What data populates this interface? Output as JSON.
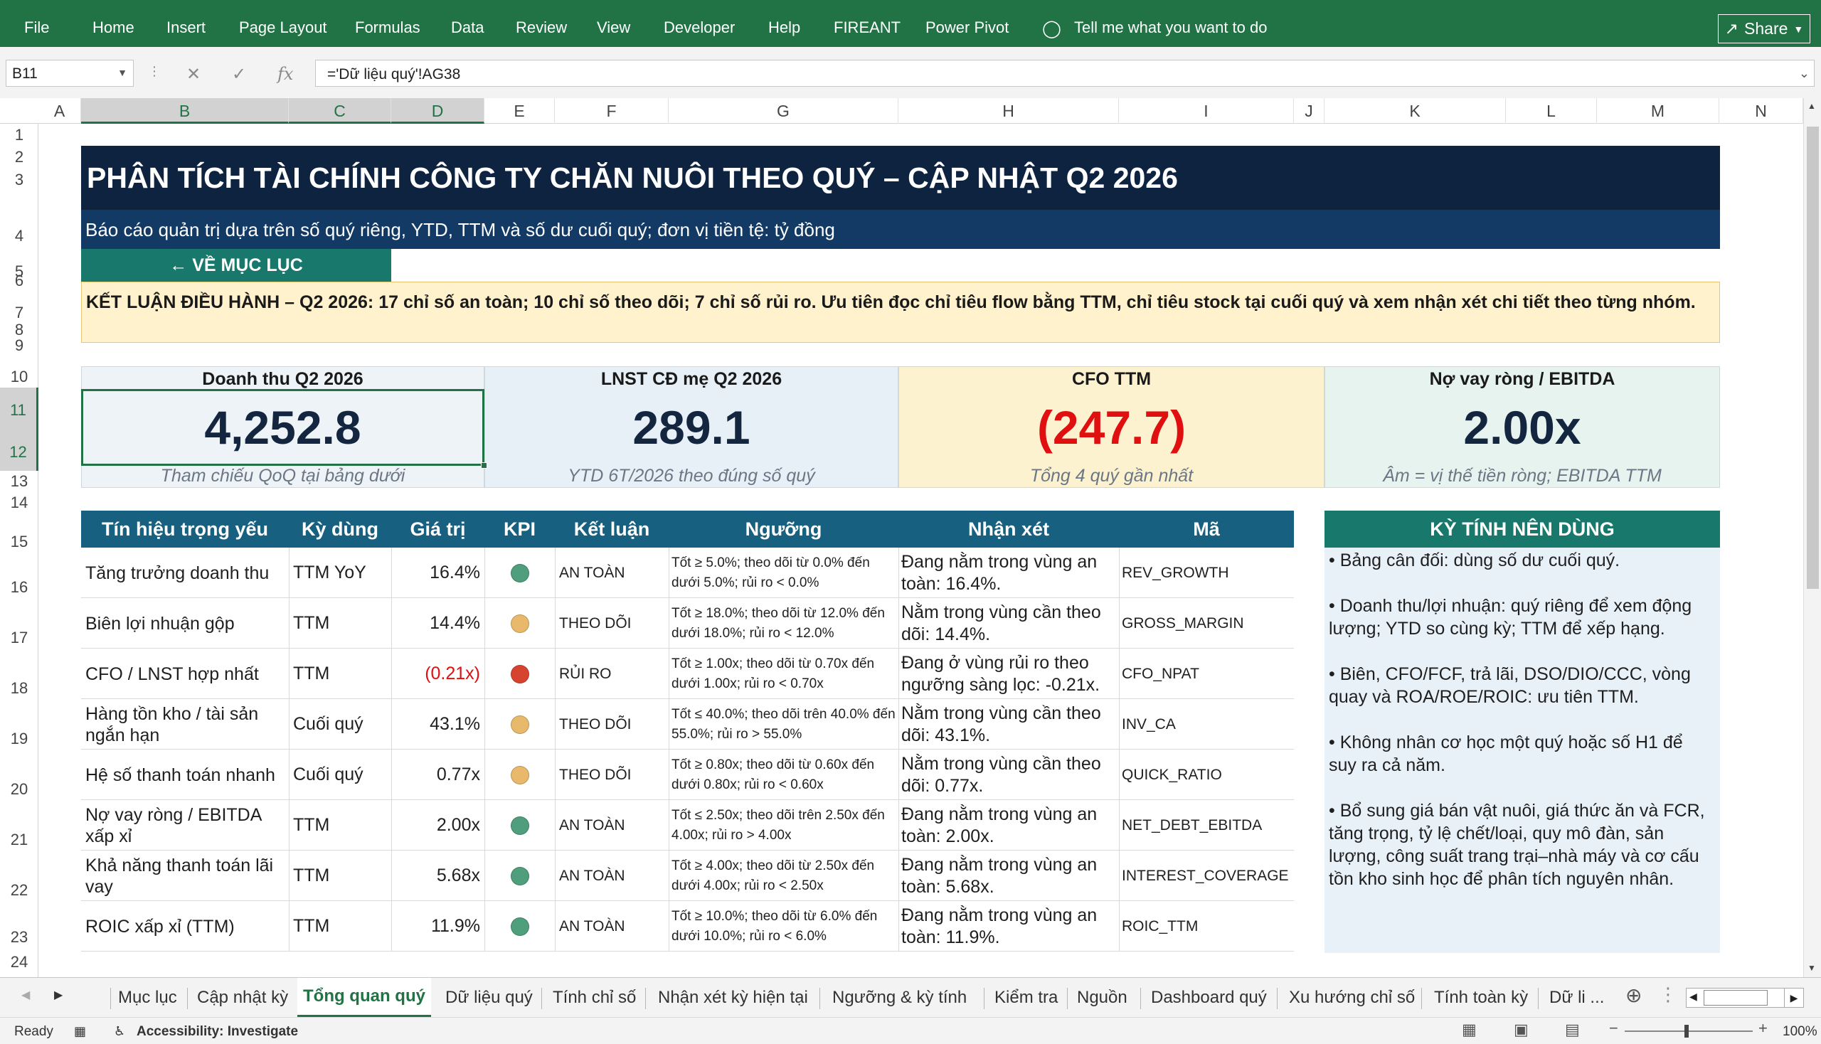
{
  "ribbon": {
    "tabs": [
      "File",
      "Home",
      "Insert",
      "Page Layout",
      "Formulas",
      "Data",
      "Review",
      "View",
      "Developer",
      "Help",
      "FIREANT",
      "Power Pivot"
    ],
    "tell_me": "Tell me what you want to do",
    "share": "Share"
  },
  "formula_bar": {
    "name_box": "B11",
    "formula": "='Dữ liệu quý'!AG38"
  },
  "columns": [
    "A",
    "B",
    "C",
    "D",
    "E",
    "F",
    "G",
    "H",
    "I",
    "J",
    "K",
    "L",
    "M",
    "N"
  ],
  "rows": [
    "1",
    "2",
    "3",
    "4",
    "5",
    "6",
    "7",
    "8",
    "9",
    "10",
    "11",
    "12",
    "13",
    "14",
    "15",
    "16",
    "17",
    "18",
    "19",
    "20",
    "21",
    "22",
    "23",
    "24"
  ],
  "sheet": {
    "title": "PHÂN TÍCH TÀI CHÍNH CÔNG TY CHĂN NUÔI THEO QUÝ – CẬP NHẬT Q2 2026",
    "subtitle": "Báo cáo quản trị dựa trên số quý riêng, YTD, TTM và số dư cuối quý; đơn vị tiền tệ: tỷ đồng",
    "back_button": "← VỀ MỤC LỤC",
    "summary": "KẾT LUẬN ĐIỀU HÀNH – Q2 2026: 17 chỉ số an toàn; 10 chỉ số theo dõi; 7 chỉ số rủi ro. Ưu tiên đọc chỉ tiêu flow bằng TTM, chỉ tiêu stock tại cuối quý và xem nhận xét chi tiết theo từng nhóm.",
    "kpis": [
      {
        "label": "Doanh thu Q2 2026",
        "value": "4,252.8",
        "note": "Tham chiếu QoQ tại bảng dưới",
        "bg": "#eef3f7"
      },
      {
        "label": "LNST CĐ mẹ Q2 2026",
        "value": "289.1",
        "note": "YTD 6T/2026 theo đúng số quý",
        "bg": "#e8f0f7"
      },
      {
        "label": "CFO TTM",
        "value": "(247.7)",
        "note": "Tổng 4 quý gần nhất",
        "bg": "#fdf2d0"
      },
      {
        "label": "Nợ vay ròng / EBITDA",
        "value": "2.00x",
        "note": "Âm = vị thế tiền ròng; EBITDA TTM",
        "bg": "#e6f3ee"
      }
    ],
    "signals_header": [
      "Tín hiệu trọng yếu",
      "Kỳ dùng",
      "Giá trị",
      "KPI",
      "Kết luận",
      "Ngưỡng",
      "Nhận xét",
      "Mã"
    ],
    "signals": [
      {
        "signal": "Tăng trưởng doanh thu",
        "period": "TTM YoY",
        "value": "16.4%",
        "status": "safe",
        "conclusion": "AN TOÀN",
        "threshold": "Tốt ≥ 5.0%; theo dõi từ 0.0% đến dưới 5.0%; rủi ro < 0.0%",
        "comment": "Đang nằm trong vùng an toàn: 16.4%.",
        "code": "REV_GROWTH"
      },
      {
        "signal": "Biên lợi nhuận gộp",
        "period": "TTM",
        "value": "14.4%",
        "status": "watch",
        "conclusion": "THEO DÕI",
        "threshold": "Tốt ≥ 18.0%; theo dõi từ 12.0% đến dưới 18.0%; rủi ro < 12.0%",
        "comment": "Nằm trong vùng cần theo dõi: 14.4%.",
        "code": "GROSS_MARGIN"
      },
      {
        "signal": "CFO / LNST hợp nhất",
        "period": "TTM",
        "value": "(0.21x)",
        "status": "risk",
        "conclusion": "RỦI RO",
        "threshold": "Tốt ≥ 1.00x; theo dõi từ 0.70x đến dưới 1.00x; rủi ro < 0.70x",
        "comment": "Đang ở vùng rủi ro theo ngưỡng sàng lọc: -0.21x.",
        "code": "CFO_NPAT"
      },
      {
        "signal": "Hàng tồn kho / tài sản ngắn hạn",
        "period": "Cuối quý",
        "value": "43.1%",
        "status": "watch",
        "conclusion": "THEO DÕI",
        "threshold": "Tốt ≤ 40.0%; theo dõi trên 40.0% đến 55.0%; rủi ro > 55.0%",
        "comment": "Nằm trong vùng cần theo dõi: 43.1%.",
        "code": "INV_CA"
      },
      {
        "signal": "Hệ số thanh toán nhanh",
        "period": "Cuối quý",
        "value": "0.77x",
        "status": "watch",
        "conclusion": "THEO DÕI",
        "threshold": "Tốt ≥ 0.80x; theo dõi từ 0.60x đến dưới 0.80x; rủi ro < 0.60x",
        "comment": "Nằm trong vùng cần theo dõi: 0.77x.",
        "code": "QUICK_RATIO"
      },
      {
        "signal": "Nợ vay ròng / EBITDA xấp xỉ",
        "period": "TTM",
        "value": "2.00x",
        "status": "safe",
        "conclusion": "AN TOÀN",
        "threshold": "Tốt ≤ 2.50x; theo dõi trên 2.50x đến 4.00x; rủi ro > 4.00x",
        "comment": "Đang nằm trong vùng an toàn: 2.00x.",
        "code": "NET_DEBT_EBITDA"
      },
      {
        "signal": "Khả năng thanh toán lãi vay",
        "period": "TTM",
        "value": "5.68x",
        "status": "safe",
        "conclusion": "AN TOÀN",
        "threshold": "Tốt ≥ 4.00x; theo dõi từ 2.50x đến dưới 4.00x; rủi ro < 2.50x",
        "comment": "Đang nằm trong vùng an toàn: 5.68x.",
        "code": "INTEREST_COVERAGE"
      },
      {
        "signal": "ROIC xấp xỉ (TTM)",
        "period": "TTM",
        "value": "11.9%",
        "status": "safe",
        "conclusion": "AN TOÀN",
        "threshold": "Tốt ≥ 10.0%; theo dõi từ 6.0% đến dưới 10.0%; rủi ro < 6.0%",
        "comment": "Đang nằm trong vùng an toàn: 11.9%.",
        "code": "ROIC_TTM"
      }
    ],
    "status_colors": {
      "safe": "#4f9e7c",
      "watch": "#e9b96b",
      "risk": "#d8432f"
    },
    "side_title": "KỲ TÍNH NÊN DÙNG",
    "side_items": [
      "• Bảng cân đối: dùng số dư cuối quý.",
      "• Doanh thu/lợi nhuận: quý riêng để xem động lượng; YTD so cùng kỳ; TTM để xếp hạng.",
      "• Biên, CFO/FCF, trả lãi, DSO/DIO/CCC, vòng quay và ROA/ROE/ROIC: ưu tiên TTM.",
      "• Không nhân cơ học một quý hoặc số H1 để suy ra cả năm.",
      "• Bổ sung giá bán vật nuôi, giá thức ăn và FCR, tăng trọng, tỷ lệ chết/loại, quy mô đàn, sản lượng, công suất trang trại–nhà máy và cơ cấu tồn kho sinh học để phân tích nguyên nhân."
    ]
  },
  "sheet_tabs": [
    "Mục lục",
    "Cập nhật kỳ",
    "Tổng quan quý",
    "Dữ liệu quý",
    "Tính chỉ số",
    "Nhận xét kỳ hiện tại",
    "Ngưỡng & kỳ tính",
    "Kiểm tra",
    "Nguồn",
    "Dashboard quý",
    "Xu hướng chỉ số",
    "Tính toàn kỳ",
    "Dữ li ..."
  ],
  "active_tab": "Tổng quan quý",
  "status": {
    "ready": "Ready",
    "accessibility": "Accessibility: Investigate",
    "zoom": "100%"
  }
}
